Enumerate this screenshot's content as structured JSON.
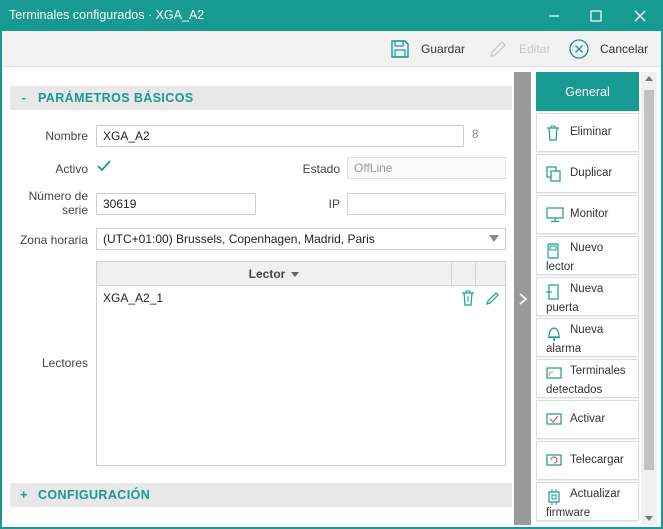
{
  "window": {
    "title": "Terminales configurados · XGA_A2"
  },
  "toolbar": {
    "save_label": "Guardar",
    "edit_label": "Editar",
    "cancel_label": "Cancelar"
  },
  "basic": {
    "section_title": "PARÁMETROS BÁSICOS",
    "section_sign": "-",
    "name_label": "Nombre",
    "name_value": "XGA_A2",
    "name_count": "8",
    "active_label": "Activo",
    "state_label": "Estado",
    "state_value": "OffLine",
    "serial_label_1": "Número de",
    "serial_label_2": "serie",
    "serial_value": "30619",
    "ip_label": "IP",
    "ip_value": "",
    "timezone_label": "Zona horaria",
    "timezone_value": "(UTC+01:00) Brussels, Copenhagen, Madrid, Paris",
    "readers_label": "Lectores",
    "readers_column": "Lector",
    "readers": [
      {
        "name": "XGA_A2_1"
      }
    ]
  },
  "config": {
    "section_title": "CONFIGURACIÓN",
    "section_sign": "+"
  },
  "sidebar": {
    "general": "General",
    "eliminar": "Eliminar",
    "duplicar": "Duplicar",
    "monitor": "Monitor",
    "nuevo_lector": [
      "Nuevo",
      "lector"
    ],
    "nueva_puerta": [
      "Nueva",
      "puerta"
    ],
    "nueva_alarma": [
      "Nueva",
      "alarma"
    ],
    "terminales_detectados": [
      "Terminales",
      "detectados"
    ],
    "activar": "Activar",
    "telecargar": "Telecargar",
    "actualizar_firmware": [
      "Actualizar",
      "firmware"
    ]
  },
  "colors": {
    "accent": "#169a92",
    "disabled": "#c8c8c8"
  }
}
